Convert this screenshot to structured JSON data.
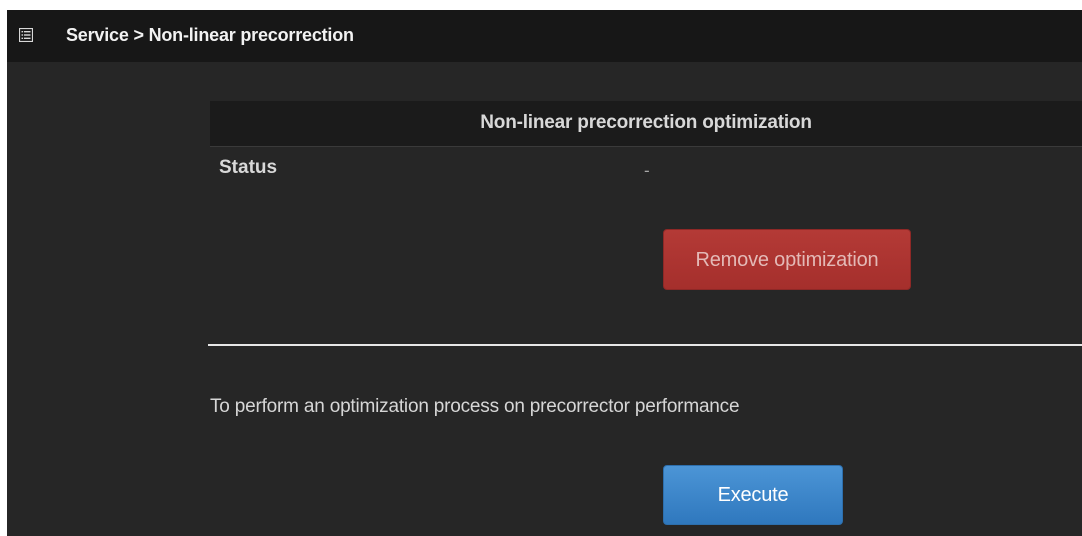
{
  "header": {
    "icon": "list-icon",
    "breadcrumb": "Service > Non-linear precorrection"
  },
  "section": {
    "title": "Non-linear precorrection optimization",
    "status_label": "Status",
    "status_value": "-",
    "remove_button_label": "Remove optimization"
  },
  "execute_section": {
    "description": "To perform an optimization process on precorrector performance",
    "execute_button_label": "Execute"
  },
  "colors": {
    "page_background": "#262626",
    "titlebar_background": "#171717",
    "danger_button": "#a52f2c",
    "primary_button": "#2f78be"
  }
}
